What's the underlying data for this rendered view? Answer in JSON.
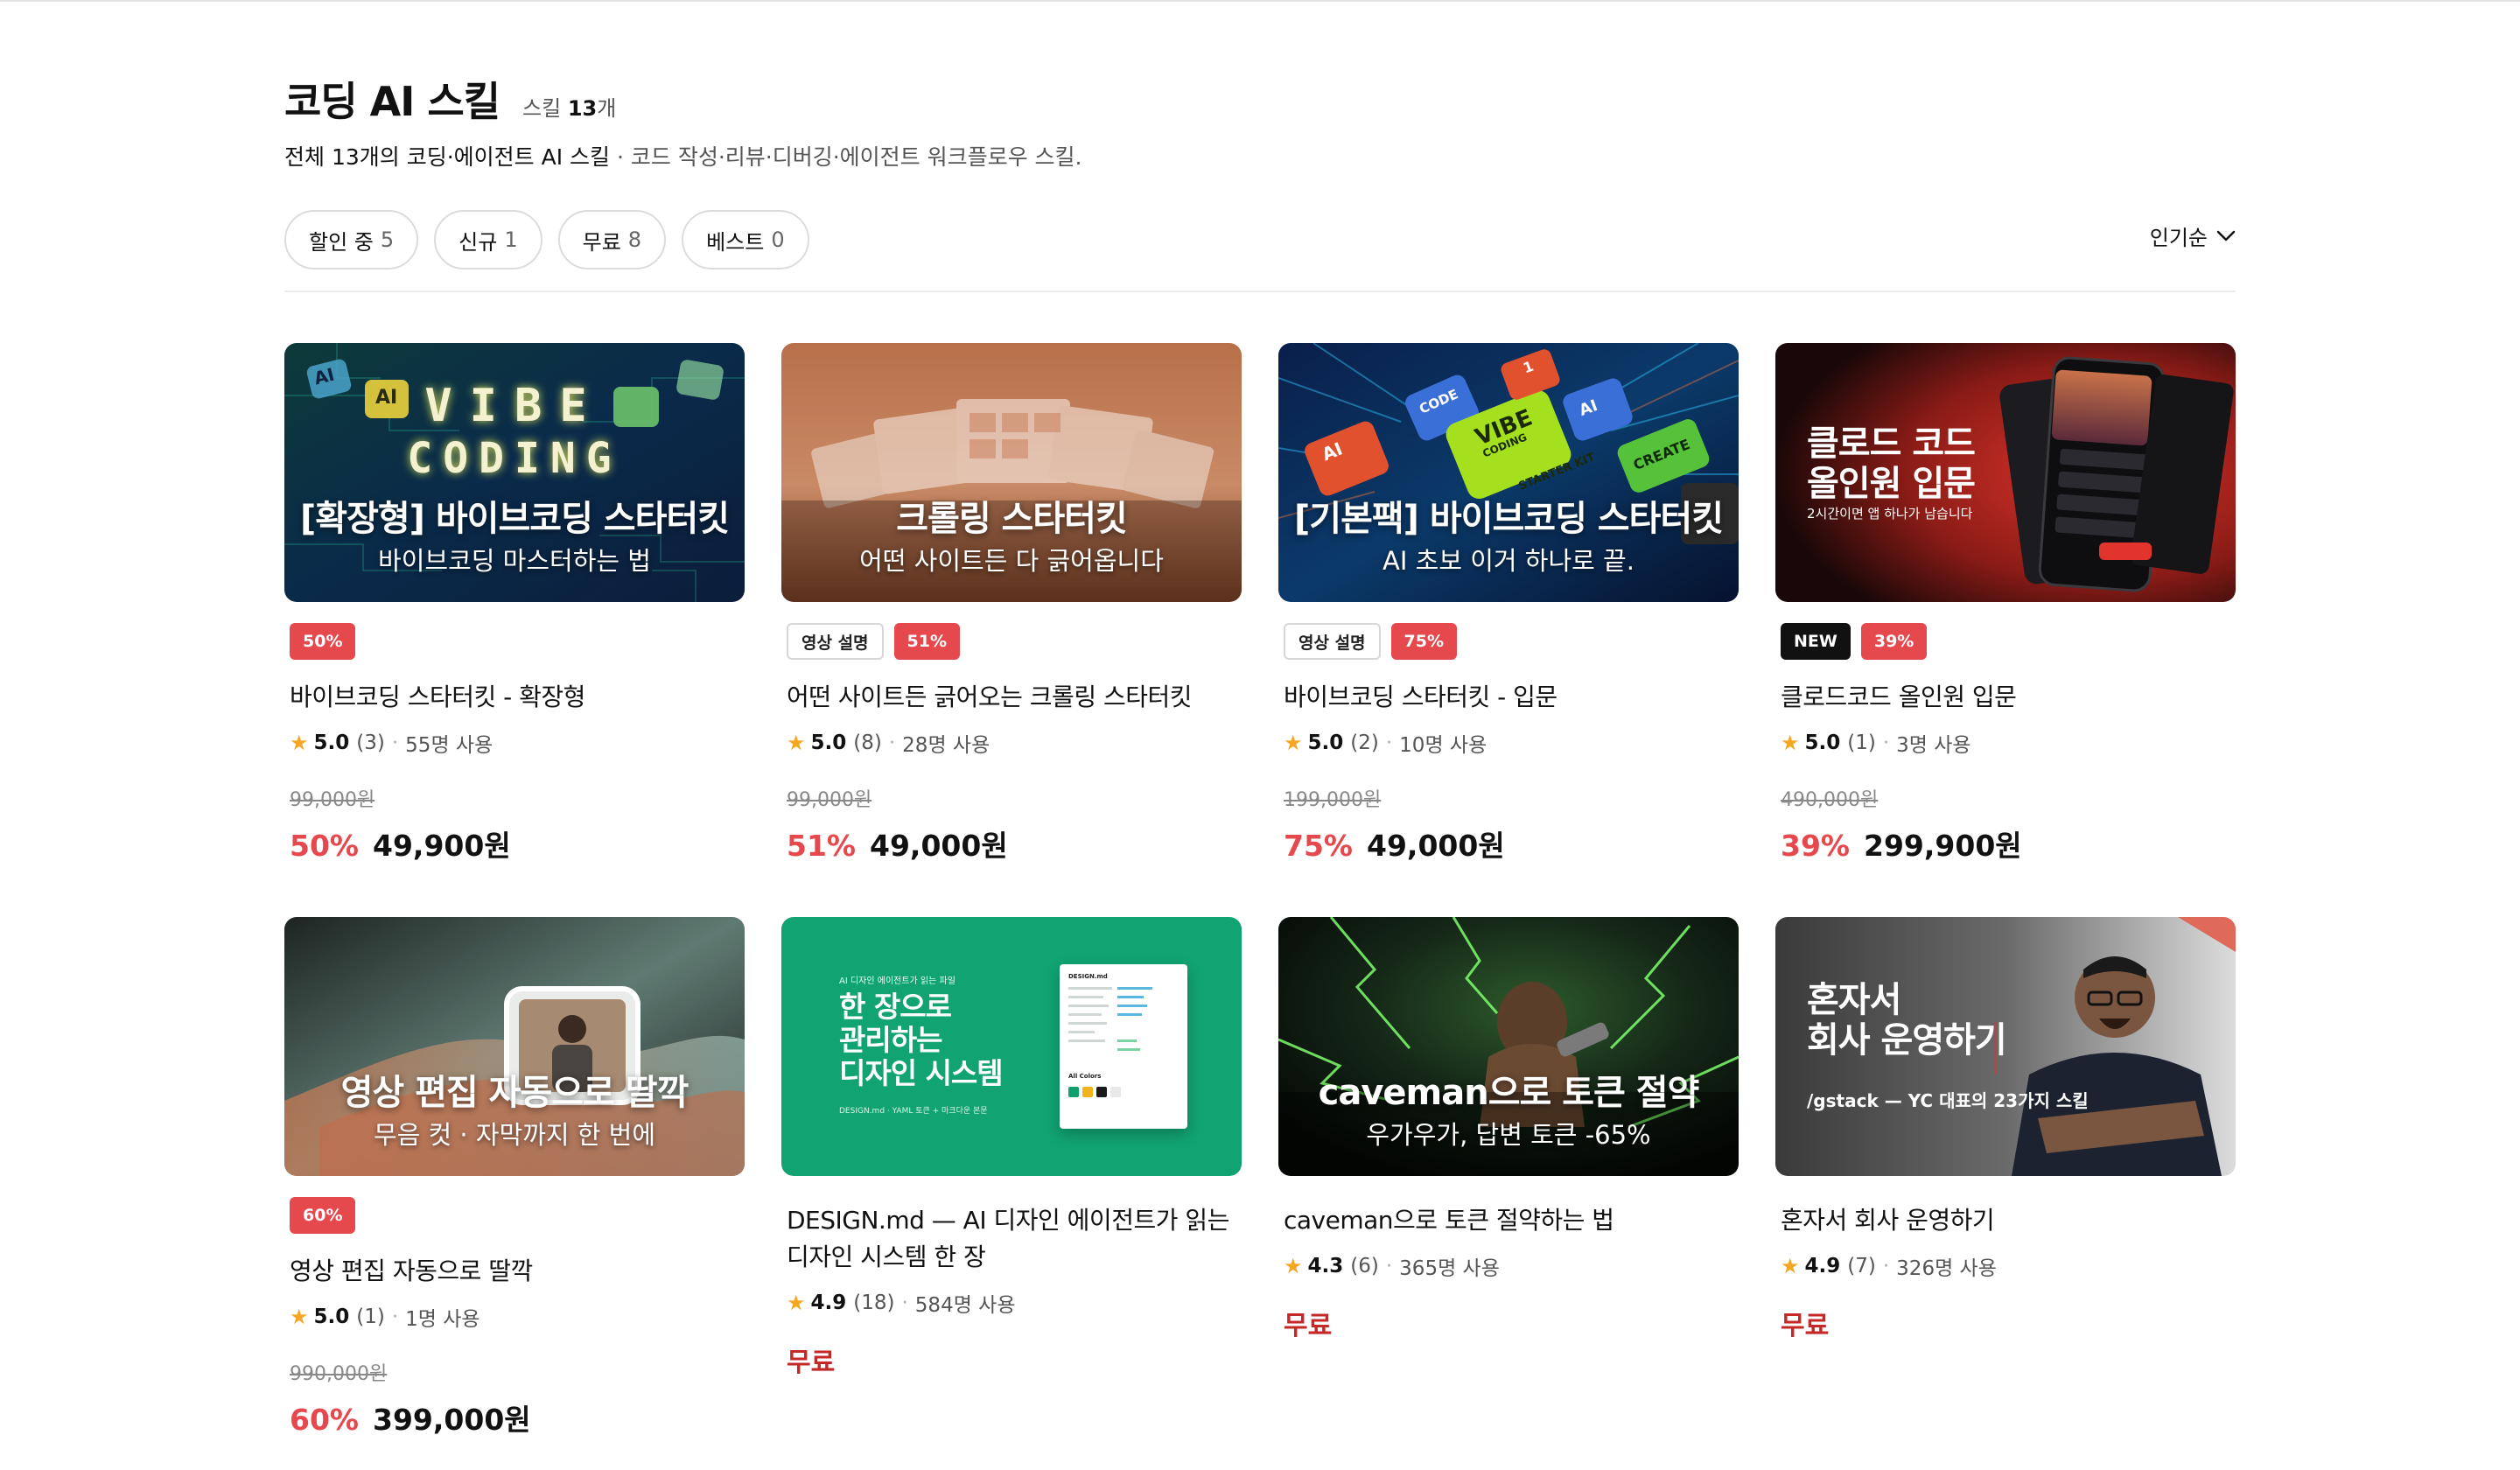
{
  "header": {
    "title": "코딩 AI 스킬",
    "count_prefix": "스킬",
    "count_value": "13",
    "count_suffix": "개",
    "description_main": "전체 13개의 코딩·에이전트 AI 스킬",
    "description_sub": " · 코드 작성·리뷰·디버깅·에이전트 워크플로우 스킬."
  },
  "filters": [
    {
      "label": "할인 중",
      "count": "5"
    },
    {
      "label": "신규",
      "count": "1"
    },
    {
      "label": "무료",
      "count": "8"
    },
    {
      "label": "베스트",
      "count": "0"
    }
  ],
  "sort": {
    "label": "인기순",
    "icon": "chevron-down-icon"
  },
  "colors": {
    "accent_red": "#e5484d",
    "free_red": "#c62828",
    "star": "#f5a623"
  },
  "products": [
    {
      "thumb": {
        "title": "[확장형] 바이브코딩 스타터킷",
        "subtitle": "바이브코딩 마스터하는 법",
        "art_line1": "VIBE",
        "art_line2": "CODING",
        "art_tag1": "AI",
        "art_tag2": "AI"
      },
      "badges": [
        "50%"
      ],
      "name": "바이브코딩 스타터킷 - 확장형",
      "rating": "5.0",
      "reviews": "(3)",
      "users": "55명 사용",
      "original_price": "99,000원",
      "discount": "50%",
      "price": "49,900원"
    },
    {
      "thumb": {
        "title": "크롤링 스타터킷",
        "subtitle": "어떤 사이트든 다 긁어옵니다"
      },
      "badges": [
        "영상 설명",
        "51%"
      ],
      "name": "어떤 사이트든 긁어오는 크롤링 스타터킷",
      "rating": "5.0",
      "reviews": "(8)",
      "users": "28명 사용",
      "original_price": "99,000원",
      "discount": "51%",
      "price": "49,000원"
    },
    {
      "thumb": {
        "title": "[기본팩] 바이브코딩 스타터킷",
        "subtitle": "AI 초보 이거 하나로 끝.",
        "art_key1": "VIBE",
        "art_key1b": "CODING",
        "art_key2": "AI",
        "art_key3": "CREATE",
        "art_key4": "CODE",
        "art_key5": "STARTER KIT",
        "art_key6": "1"
      },
      "badges": [
        "영상 설명",
        "75%"
      ],
      "name": "바이브코딩 스타터킷 - 입문",
      "rating": "5.0",
      "reviews": "(2)",
      "users": "10명 사용",
      "original_price": "199,000원",
      "discount": "75%",
      "price": "49,000원"
    },
    {
      "thumb": {
        "title_line1": "클로드 코드",
        "title_line2": "올인원 입문",
        "subtitle": "2시간이면 앱 하나가 남습니다"
      },
      "badges": [
        "NEW",
        "39%"
      ],
      "name": "클로드코드 올인원 입문",
      "rating": "5.0",
      "reviews": "(1)",
      "users": "3명 사용",
      "original_price": "490,000원",
      "discount": "39%",
      "price": "299,900원"
    },
    {
      "thumb": {
        "title": "영상 편집 자동으로 딸깍",
        "subtitle": "무음 컷 · 자막까지 한 번에"
      },
      "badges": [
        "60%"
      ],
      "name": "영상 편집 자동으로 딸깍",
      "rating": "5.0",
      "reviews": "(1)",
      "users": "1명 사용",
      "original_price": "990,000원",
      "discount": "60%",
      "price": "399,000원"
    },
    {
      "thumb": {
        "kicker": "AI 디자인 에이전트가 읽는 파일",
        "title_line1": "한 장으로",
        "title_line2": "관리하는",
        "title_line3": "디자인 시스템",
        "footnote": "DESIGN.md · YAML 토큰 + 마크다운 본문",
        "doc_title": "DESIGN.md",
        "doc_section": "All Colors"
      },
      "badges": [],
      "name_line1": "DESIGN.md — AI 디자인 에이전트가 읽는",
      "name_line2": "디자인 시스템 한 장",
      "rating": "4.9",
      "reviews": "(18)",
      "users": "584명 사용",
      "price_label": "무료"
    },
    {
      "thumb": {
        "title": "caveman으로 토큰 절약",
        "subtitle": "우가우가, 답변 토큰 -65%"
      },
      "badges": [],
      "name": "caveman으로 토큰 절약하는 법",
      "rating": "4.3",
      "reviews": "(6)",
      "users": "365명 사용",
      "price_label": "무료"
    },
    {
      "thumb": {
        "title_line1": "혼자서",
        "title_line2": "회사 운영하기",
        "subtitle": "/gstack — YC 대표의 23가지 스킬"
      },
      "badges": [],
      "name": "혼자서 회사 운영하기",
      "rating": "4.9",
      "reviews": "(7)",
      "users": "326명 사용",
      "price_label": "무료"
    }
  ]
}
